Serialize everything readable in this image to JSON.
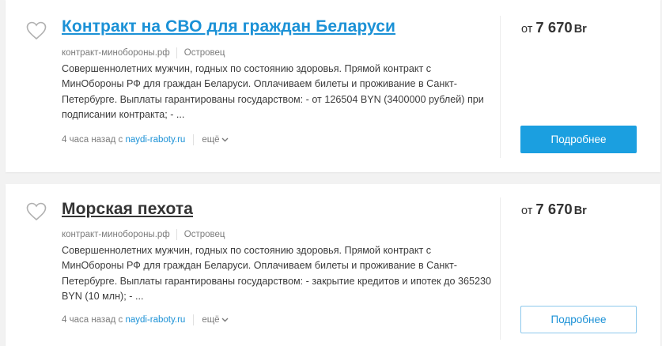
{
  "listings": [
    {
      "title": "Контракт на СВО для граждан Беларуси",
      "source": "контракт-минобороны.рф",
      "location": "Островец",
      "description": "Совершеннолетних мужчин, годных по состоянию здоровья. Прямой контракт с МинОбороны РФ для граждан Беларуси. Оплачиваем билеты и проживание в Санкт-Петербурге. Выплаты гарантированы государством: - от 126504 BYN (3400000 рублей) при подписании контракта; - ...",
      "posted": "4 часа назад с",
      "site": "naydi-raboty.ru",
      "more": "ещё",
      "salary_from": "от",
      "salary_amount": "7 670",
      "salary_currency": "Br",
      "button": "Подробнее"
    },
    {
      "title": "Морская пехота",
      "source": "контракт-минобороны.рф",
      "location": "Островец",
      "description": "Совершеннолетних мужчин, годных по состоянию здоровья. Прямой контракт с МинОбороны РФ для граждан Беларуси. Оплачиваем билеты и проживание в Санкт-Петербурге. Выплаты гарантированы государством: - закрытие кредитов и ипотек до 365230 BYN (10 млн); - ...",
      "posted": "4 часа назад с",
      "site": "naydi-raboty.ru",
      "more": "ещё",
      "salary_from": "от",
      "salary_amount": "7 670",
      "salary_currency": "Br",
      "button": "Подробнее"
    }
  ],
  "icons": {
    "favorite": "heart-outline-icon",
    "more": "chevron-down-icon"
  },
  "colors": {
    "link_blue": "#1b91d6",
    "button_blue": "#1b9fe0",
    "text_dark": "#333333",
    "text_muted": "#7b7b7b",
    "background": "#f2f2f2"
  }
}
